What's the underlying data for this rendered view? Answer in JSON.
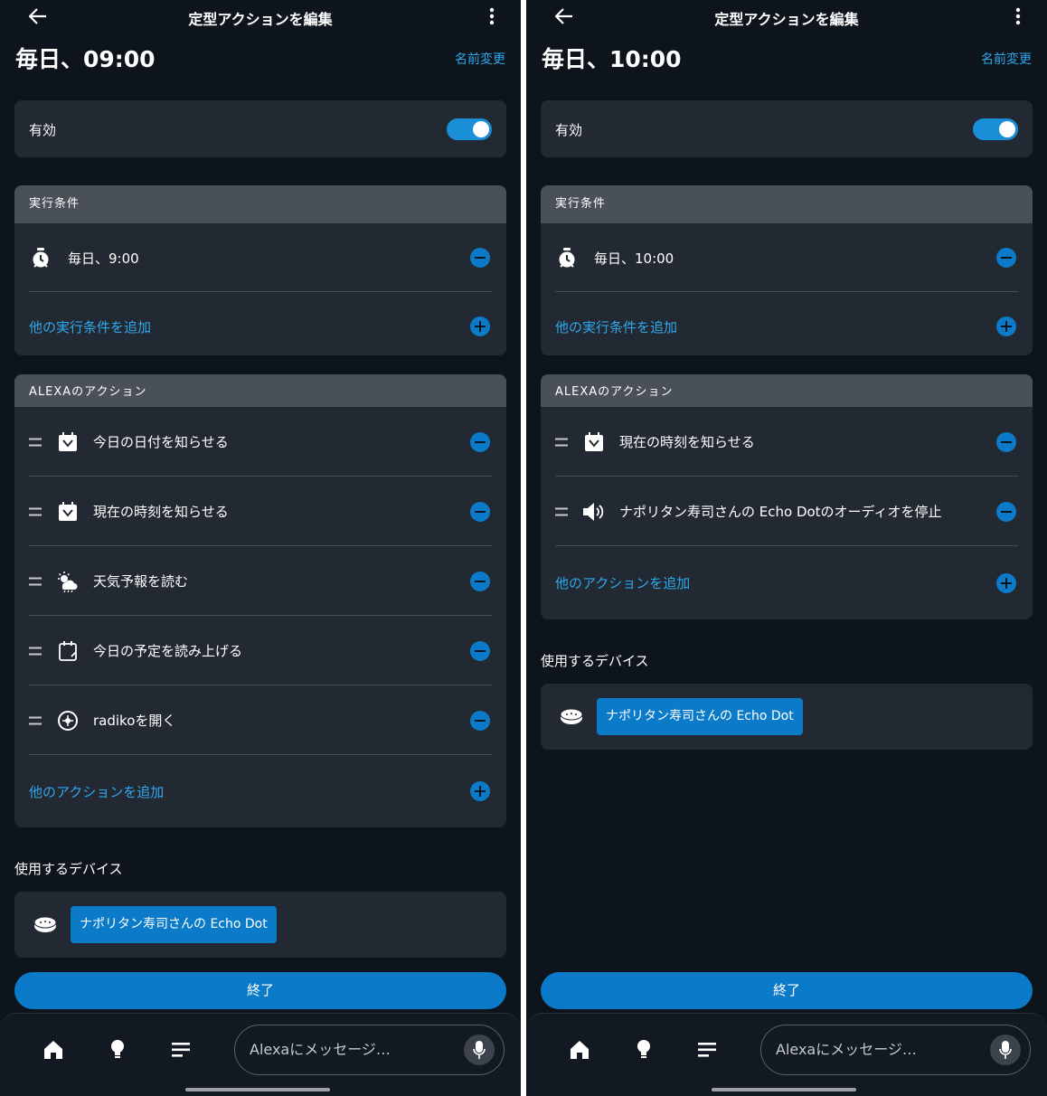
{
  "colors": {
    "background": "#0d141c",
    "card": "#232932",
    "accent": "#0b7ac8",
    "link": "#2ea8ec",
    "section_header": "#4a5058"
  },
  "header": {
    "title": "定型アクションを編集",
    "rename": "名前変更"
  },
  "enable_label": "有効",
  "enabled": true,
  "conditions_title": "実行条件",
  "add_condition_label": "他の実行条件を追加",
  "actions_title": "ALEXAのアクション",
  "add_action_label": "他のアクションを追加",
  "devices_title": "使用するデバイス",
  "device_name": "ナポリタン寿司さんの Echo Dot",
  "done_label": "終了",
  "bottom_nav": {
    "message_placeholder": "Alexaにメッセージ…",
    "icons": [
      "home-icon",
      "bulb-icon",
      "list-icon",
      "mic-icon"
    ]
  },
  "routines": [
    {
      "name": "毎日、09:00",
      "condition": {
        "icon": "alarm-clock-icon",
        "label": "毎日、9:00"
      },
      "actions": [
        {
          "icon": "calendar-clock-icon",
          "label": "今日の日付を知らせる"
        },
        {
          "icon": "calendar-clock-icon",
          "label": "現在の時刻を知らせる"
        },
        {
          "icon": "weather-icon",
          "label": "天気予報を読む"
        },
        {
          "icon": "calendar-icon",
          "label": "今日の予定を読み上げる"
        },
        {
          "icon": "radiko-icon",
          "label": "radikoを開く"
        }
      ]
    },
    {
      "name": "毎日、10:00",
      "condition": {
        "icon": "alarm-clock-icon",
        "label": "毎日、10:00"
      },
      "actions": [
        {
          "icon": "calendar-clock-icon",
          "label": "現在の時刻を知らせる"
        },
        {
          "icon": "speaker-icon",
          "label": "ナポリタン寿司さんの Echo Dotのオーディオを停止"
        }
      ]
    }
  ]
}
